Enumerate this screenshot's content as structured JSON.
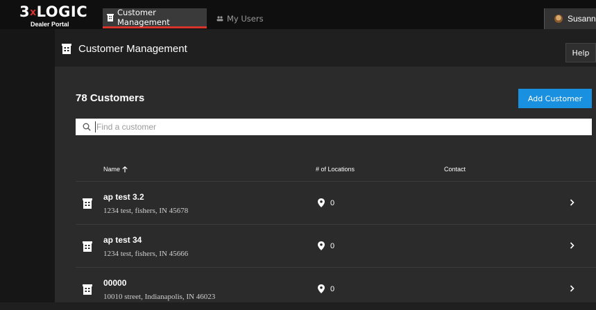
{
  "brand": {
    "logo_main": "3",
    "logo_x": "x",
    "logo_rest": "LOGIC",
    "logo_sub": "Dealer Portal",
    "accent": "#d9342b"
  },
  "nav": {
    "tabs": [
      {
        "label": "Customer Management",
        "icon": "building-icon",
        "active": true
      },
      {
        "label": "My Users",
        "icon": "users-icon",
        "active": false
      }
    ],
    "user_name": "Susanne"
  },
  "header": {
    "title": "Customer Management",
    "help_label": "Help"
  },
  "panel": {
    "count_label": "78 Customers",
    "add_label": "Add Customer",
    "add_color": "#1a90e0",
    "search_placeholder": "Find a customer"
  },
  "table": {
    "columns": [
      "Name",
      "# of Locations",
      "Contact"
    ],
    "sort_indicator": "arrow-up-icon",
    "rows": [
      {
        "name": "ap test 3.2",
        "address": "1234 test, fishers, IN 45678",
        "locations": "0",
        "contact": ""
      },
      {
        "name": "ap test 34",
        "address": "1234 test, fishers, IN 45666",
        "locations": "0",
        "contact": ""
      },
      {
        "name": "00000",
        "address": "10010 street, Indianapolis, IN 46023",
        "locations": "0",
        "contact": ""
      }
    ]
  }
}
